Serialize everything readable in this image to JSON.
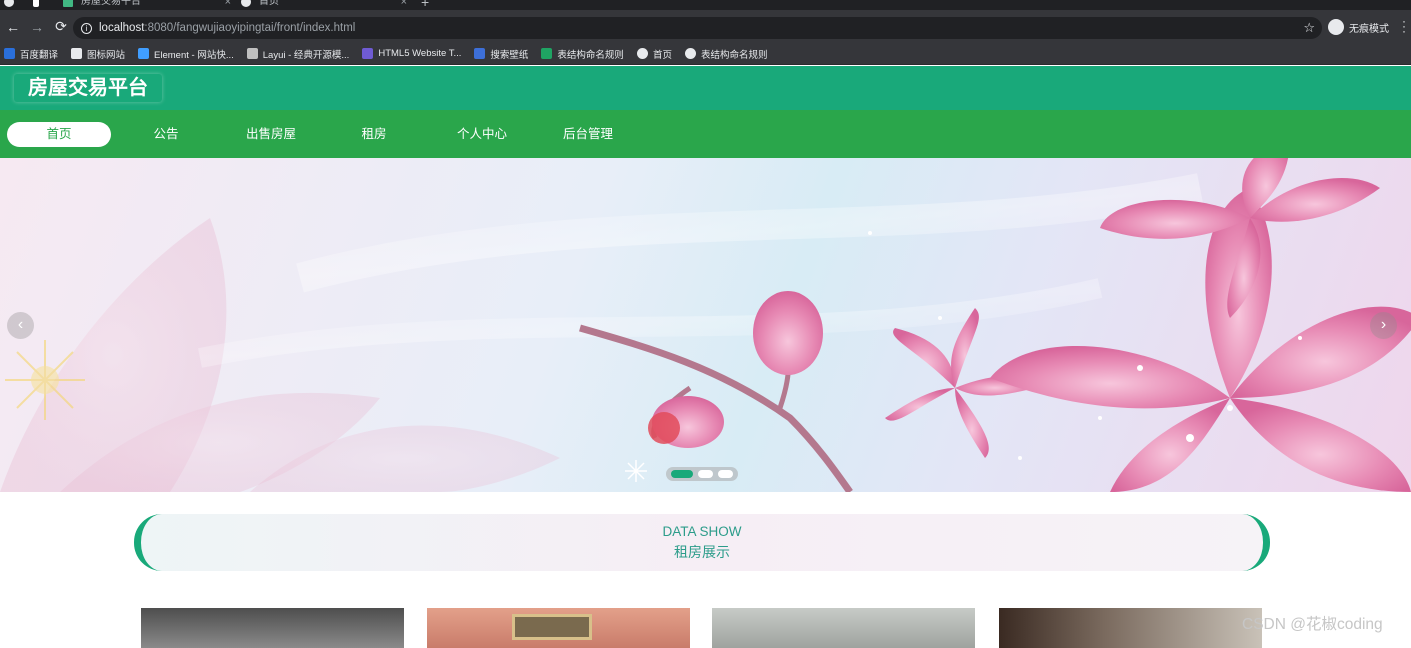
{
  "browser": {
    "tabs": [
      {
        "title": "房屋交易平台"
      },
      {
        "title": "首页"
      }
    ],
    "address": {
      "host": "localhost",
      "path": ":8080/fangwujiaoyipingtai/front/index.html"
    },
    "profile_label": "无痕模式",
    "bookmarks": [
      {
        "label": "百度翻译",
        "color": "#2a6fdb"
      },
      {
        "label": "图标网站",
        "color": "#e8eaed"
      },
      {
        "label": "Element - 网站快...",
        "color": "#409eff"
      },
      {
        "label": "Layui - 经典开源模...",
        "color": "#c0c0c0"
      },
      {
        "label": "HTML5 Website T...",
        "color": "#6f5bd3"
      },
      {
        "label": "搜索壁纸",
        "color": "#3d6fd8"
      },
      {
        "label": "表结构命名规则",
        "color": "#1fa463"
      },
      {
        "label": "首页",
        "color": "#e8eaed"
      },
      {
        "label": "表结构命名规则",
        "color": "#e8eaed"
      }
    ]
  },
  "site": {
    "title": "房屋交易平台",
    "nav": [
      {
        "label": "首页",
        "active": true
      },
      {
        "label": "公告"
      },
      {
        "label": "出售房屋"
      },
      {
        "label": "租房"
      },
      {
        "label": "个人中心"
      },
      {
        "label": "后台管理"
      }
    ],
    "banner": {
      "prev": "‹",
      "next": "›",
      "slide_count": 3,
      "active_slide": 1
    },
    "section": {
      "title_en": "DATA SHOW",
      "title_cn": "租房展示"
    },
    "watermark": "CSDN @花椒coding"
  },
  "colors": {
    "header": "#19a97a",
    "nav": "#2aa64b",
    "accent": "#19a97a"
  }
}
